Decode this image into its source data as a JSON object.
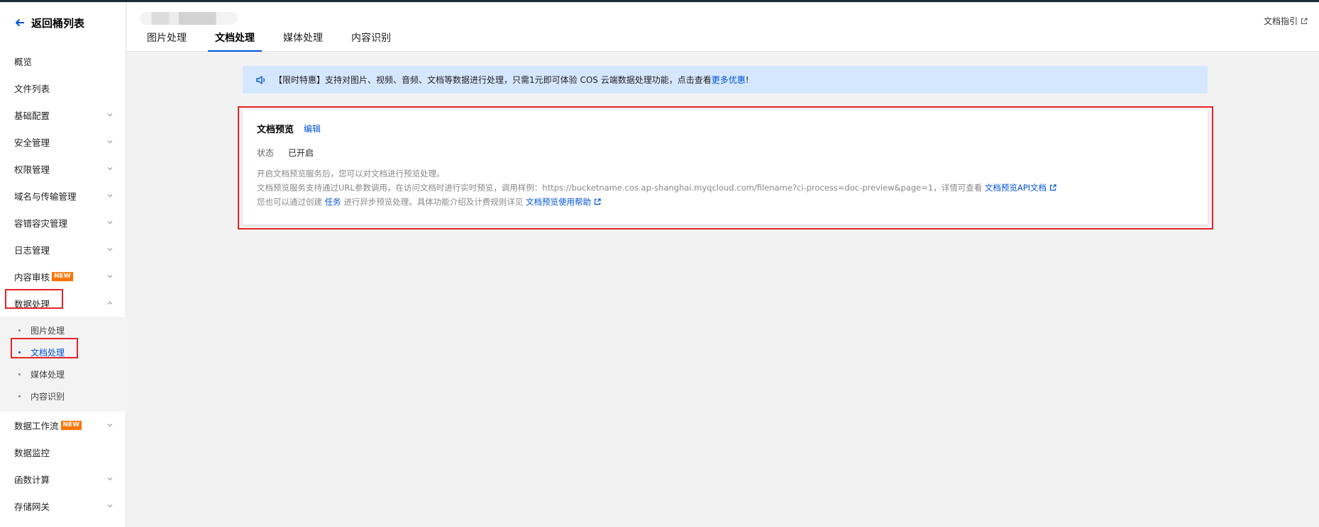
{
  "sidebar": {
    "back_label": "返回桶列表",
    "items": [
      {
        "label": "概览",
        "chevron": false
      },
      {
        "label": "文件列表",
        "chevron": false
      },
      {
        "label": "基础配置",
        "chevron": true
      },
      {
        "label": "安全管理",
        "chevron": true
      },
      {
        "label": "权限管理",
        "chevron": true
      },
      {
        "label": "域名与传输管理",
        "chevron": true
      },
      {
        "label": "容错容灾管理",
        "chevron": true
      },
      {
        "label": "日志管理",
        "chevron": true
      },
      {
        "label": "内容审核",
        "chevron": true,
        "badge": "NEW"
      },
      {
        "label": "数据处理",
        "chevron": true,
        "expanded": true
      }
    ],
    "sub_items": [
      {
        "label": "图片处理",
        "active": false
      },
      {
        "label": "文档处理",
        "active": true
      },
      {
        "label": "媒体处理",
        "active": false
      },
      {
        "label": "内容识别",
        "active": false
      }
    ],
    "items_after": [
      {
        "label": "数据工作流",
        "chevron": true,
        "badge": "NEW"
      },
      {
        "label": "数据监控",
        "chevron": false
      },
      {
        "label": "函数计算",
        "chevron": true
      },
      {
        "label": "存储网关",
        "chevron": true
      }
    ]
  },
  "header": {
    "tabs": [
      {
        "label": "图片处理",
        "active": false
      },
      {
        "label": "文档处理",
        "active": true
      },
      {
        "label": "媒体处理",
        "active": false
      },
      {
        "label": "内容识别",
        "active": false
      }
    ],
    "doc_guide": "文档指引"
  },
  "banner": {
    "text": "【限时特惠】支持对图片、视频、音频、文档等数据进行处理，只需1元即可体验 COS 云端数据处理功能，点击查看",
    "link": "更多优惠",
    "suffix": "!"
  },
  "card": {
    "title": "文档预览",
    "edit": "编辑",
    "status_key": "状态",
    "status_value": "已开启",
    "line1": "开启文档预览服务后，您可以对文档进行预览处理。",
    "line2": "文档预览服务支持通过URL参数调用，在访问文档时进行实时预览，调用样例：https://bucketname.cos.ap-shanghai.myqcloud.com/filename?ci-process=doc-preview&page=1，详情可查看",
    "line2_link": "文档预览API文档",
    "line3_prefix": "您也可以通过创建",
    "line3_task": "任务",
    "line3_mid": "进行异步预览处理。具体功能介绍及计费规则详见",
    "line3_link": "文档预览使用帮助"
  },
  "colors": {
    "accent": "#0052d9",
    "highlight": "#e5232a",
    "banner_bg": "#d5e7ff",
    "badge": "#ff7200"
  }
}
